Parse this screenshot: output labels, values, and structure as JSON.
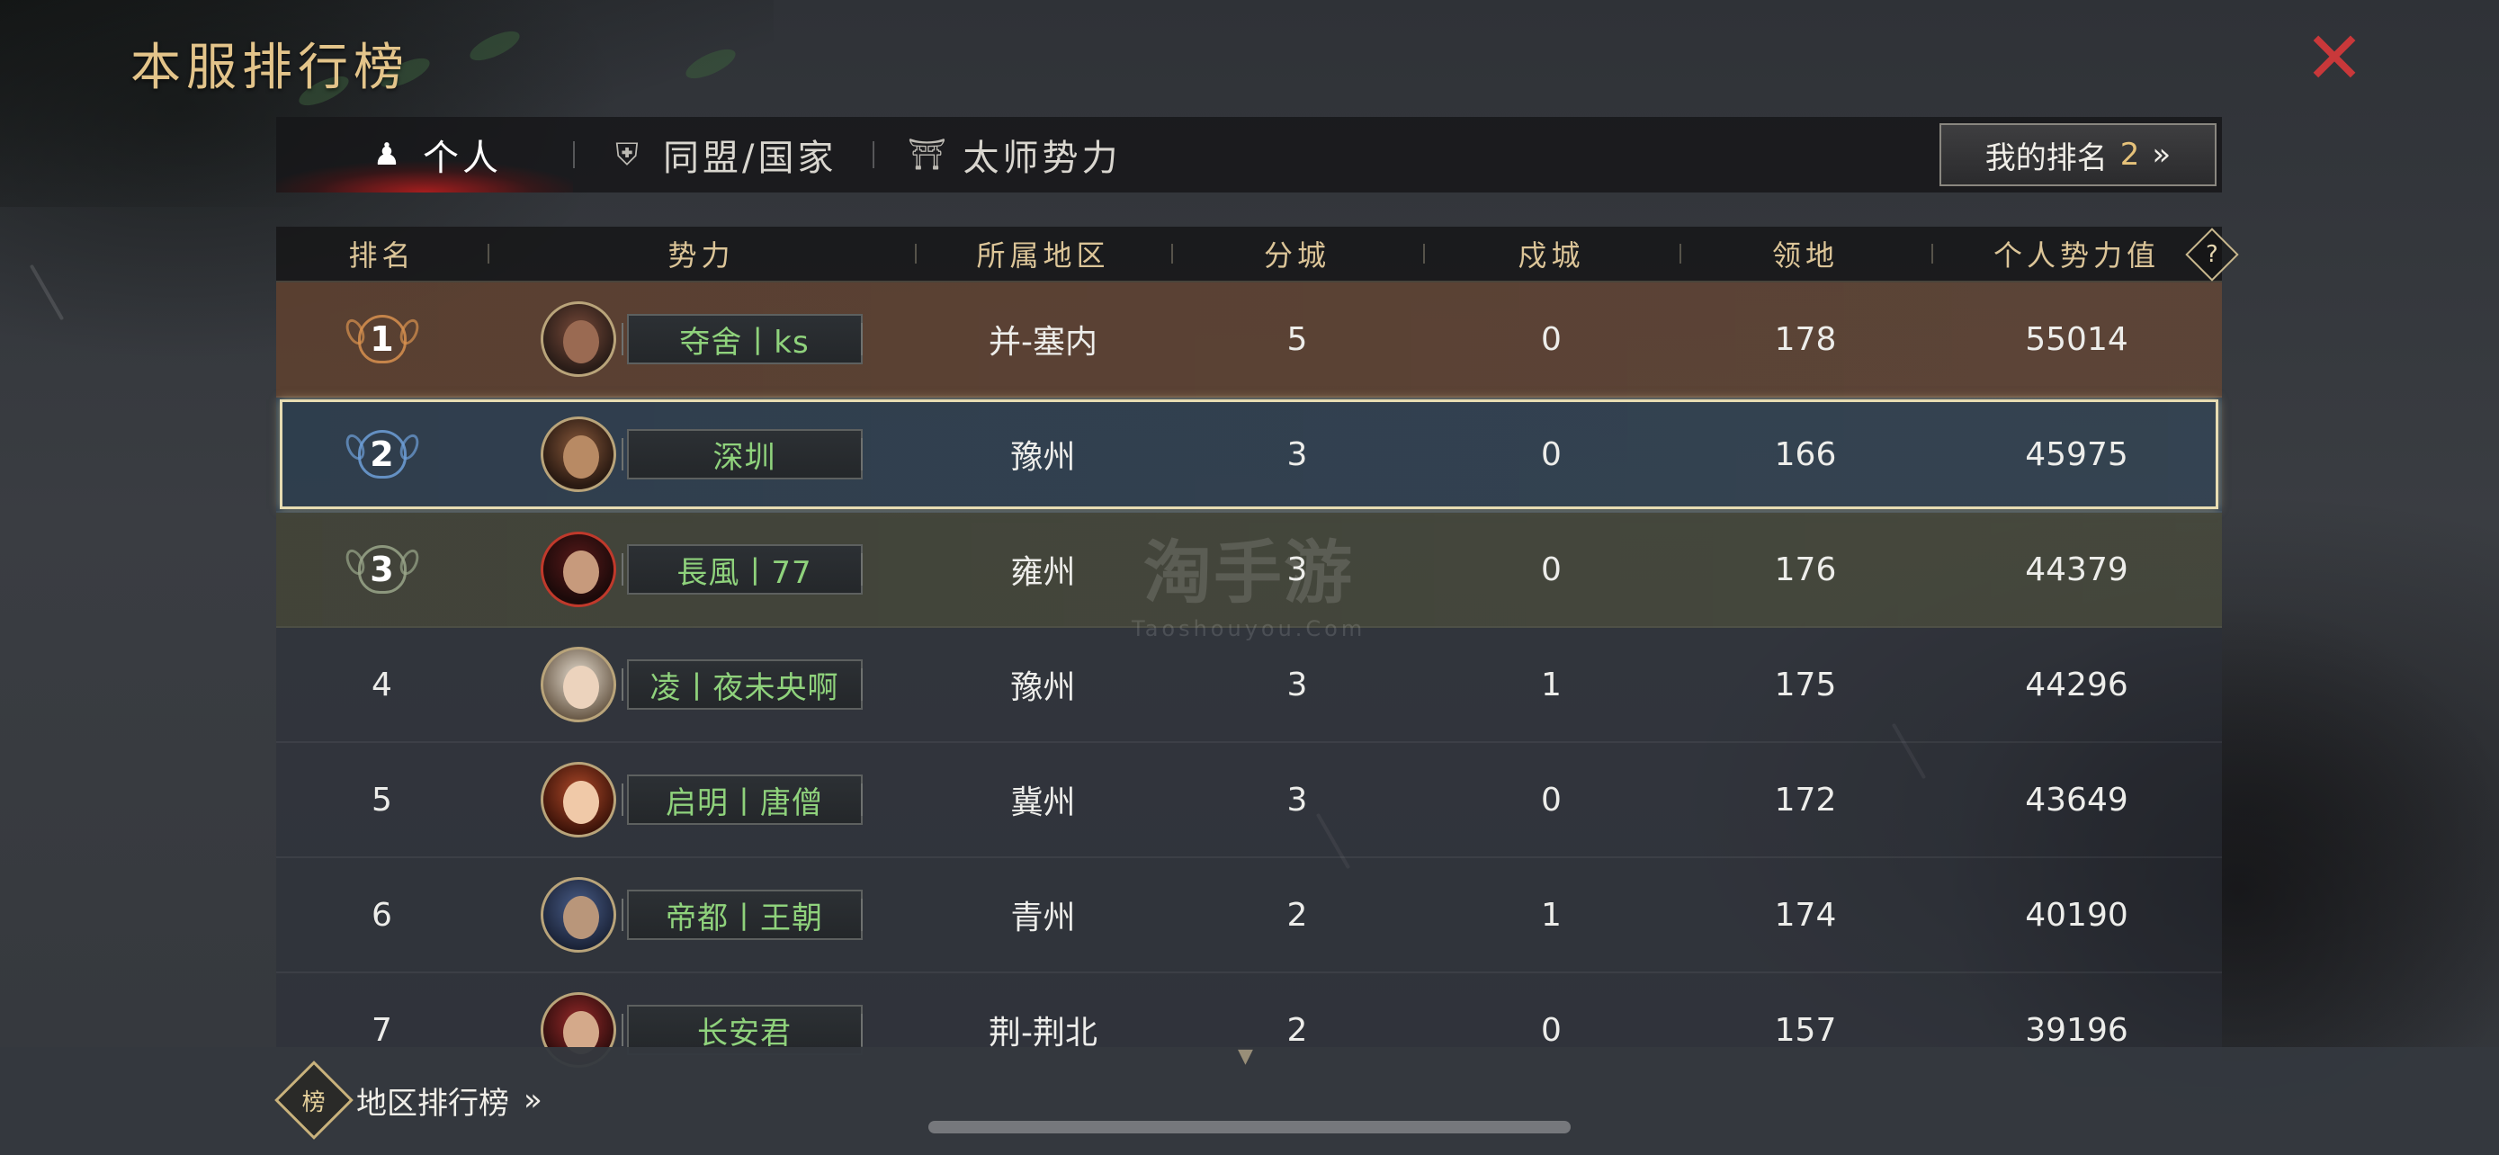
{
  "title": "本服排行榜",
  "close_label": "✕",
  "tabs": [
    {
      "label": "个人",
      "icon": "person-icon",
      "active": true
    },
    {
      "label": "同盟/国家",
      "icon": "alliance-icon",
      "active": false
    },
    {
      "label": "太师势力",
      "icon": "banner-icon",
      "active": false
    }
  ],
  "my_rank": {
    "label": "我的排名",
    "value": "2",
    "chevron": "»"
  },
  "table": {
    "headers": [
      "排名",
      "势力",
      "所属地区",
      "分城",
      "戍城",
      "领地",
      "个人势力值"
    ],
    "help_label": "?",
    "rows": [
      {
        "rank": "1",
        "name": "夺舍丨ks",
        "region": "并-塞内",
        "branch": "5",
        "garrison": "0",
        "land": "178",
        "power": "55014"
      },
      {
        "rank": "2",
        "name": "深圳",
        "region": "豫州",
        "branch": "3",
        "garrison": "0",
        "land": "166",
        "power": "45975"
      },
      {
        "rank": "3",
        "name": "長風丨77",
        "region": "雍州",
        "branch": "3",
        "garrison": "0",
        "land": "176",
        "power": "44379"
      },
      {
        "rank": "4",
        "name": "凌丨夜未央啊",
        "region": "豫州",
        "branch": "3",
        "garrison": "1",
        "land": "175",
        "power": "44296"
      },
      {
        "rank": "5",
        "name": "启明丨唐僧",
        "region": "冀州",
        "branch": "3",
        "garrison": "0",
        "land": "172",
        "power": "43649"
      },
      {
        "rank": "6",
        "name": "帝都丨王朝",
        "region": "青州",
        "branch": "2",
        "garrison": "1",
        "land": "174",
        "power": "40190"
      },
      {
        "rank": "7",
        "name": "长安君",
        "region": "荆-荆北",
        "branch": "2",
        "garrison": "0",
        "land": "157",
        "power": "39196"
      }
    ]
  },
  "region_ranking": {
    "label": "地区排行榜",
    "chevron": "»",
    "icon_text": "榜"
  },
  "watermark": {
    "big": "淘手游",
    "small": "Taoshouyou.Com"
  },
  "colors": {
    "accent_gold": "#e3c48a",
    "name_green": "#8fd27c",
    "close_red": "#c9383a"
  }
}
